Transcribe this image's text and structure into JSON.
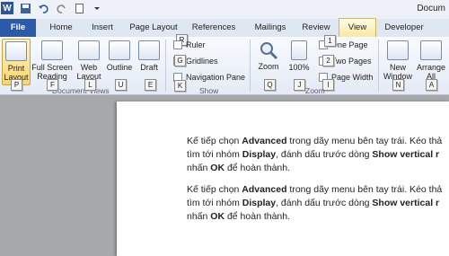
{
  "title_bar": {
    "doc_title": "Docum"
  },
  "tabs": [
    "File",
    "Home",
    "Insert",
    "Page Layout",
    "References",
    "Mailings",
    "Review",
    "View",
    "Developer"
  ],
  "ribbon": {
    "document_views": {
      "label": "Document Views",
      "buttons": [
        "Print Layout",
        "Full Screen Reading",
        "Web Layout",
        "Outline",
        "Draft"
      ],
      "keys": [
        "P",
        "F",
        "L",
        "U",
        "E"
      ]
    },
    "show": {
      "label": "Show",
      "key_top": "R",
      "items": [
        "Ruler",
        "Gridlines",
        "Navigation Pane"
      ],
      "keys": [
        "R",
        "G",
        "K"
      ]
    },
    "zoom": {
      "label": "Zoom",
      "buttons": [
        "Zoom",
        "100%"
      ],
      "items": [
        "One Page",
        "Two Pages",
        "Page Width"
      ],
      "keys": [
        "Q",
        "J",
        "1",
        "2",
        "I"
      ]
    },
    "window": {
      "buttons": [
        "New Window",
        "Arrange All"
      ],
      "keys": [
        "N",
        "A"
      ]
    }
  },
  "document": {
    "paragraphs": [
      {
        "line1_a": "Kế tiếp chọn ",
        "line1_b": "Advanced",
        "line1_c": " trong dãy menu bên tay trái. Kéo thả",
        "line2_a": "tìm tới nhóm ",
        "line2_b": "Display",
        "line2_c": ", đánh dấu trước dòng ",
        "line2_d": "Show vertical r",
        "line3_a": "nhấn ",
        "line3_b": "OK",
        "line3_c": " để hoàn thành."
      },
      {
        "line1_a": "Kế tiếp chọn ",
        "line1_b": "Advanced",
        "line1_c": " trong dãy menu bên tay trái. Kéo thả",
        "line2_a": "tìm tới nhóm ",
        "line2_b": "Display",
        "line2_c": ", đánh dấu trước dòng ",
        "line2_d": "Show vertical r",
        "line3_a": "nhấn ",
        "line3_b": "OK",
        "line3_c": " để hoàn thành."
      }
    ]
  }
}
